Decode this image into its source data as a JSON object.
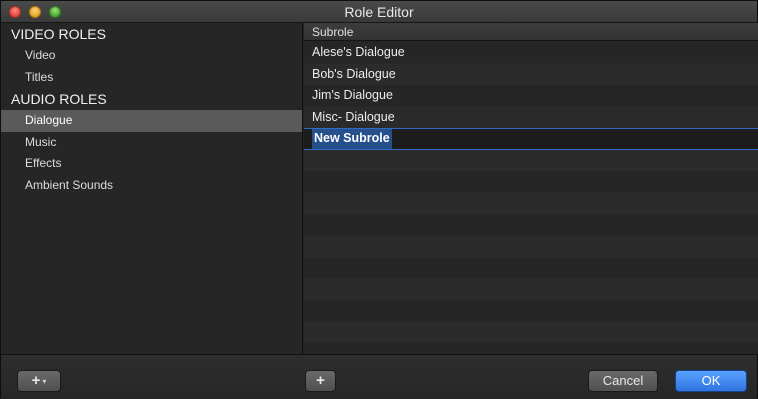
{
  "window": {
    "title": "Role Editor"
  },
  "sidebar": {
    "video_header": "VIDEO ROLES",
    "video_items": [
      "Video",
      "Titles"
    ],
    "audio_header": "AUDIO ROLES",
    "audio_items": [
      "Dialogue",
      "Music",
      "Effects",
      "Ambient Sounds"
    ],
    "selected": "Dialogue"
  },
  "subroles": {
    "column_header": "Subrole",
    "items": [
      "Alese's Dialogue",
      "Bob's Dialogue",
      "Jim's Dialogue",
      "Misc- Dialogue"
    ],
    "editing_value": "New Subrole"
  },
  "buttons": {
    "add_role": "+",
    "add_role_menu": "▾",
    "add_subrole": "+",
    "cancel": "Cancel",
    "ok": "OK"
  },
  "colors": {
    "accent": "#2d74e0",
    "selection": "#5a5a5a",
    "edit_highlight": "#264f8e"
  }
}
